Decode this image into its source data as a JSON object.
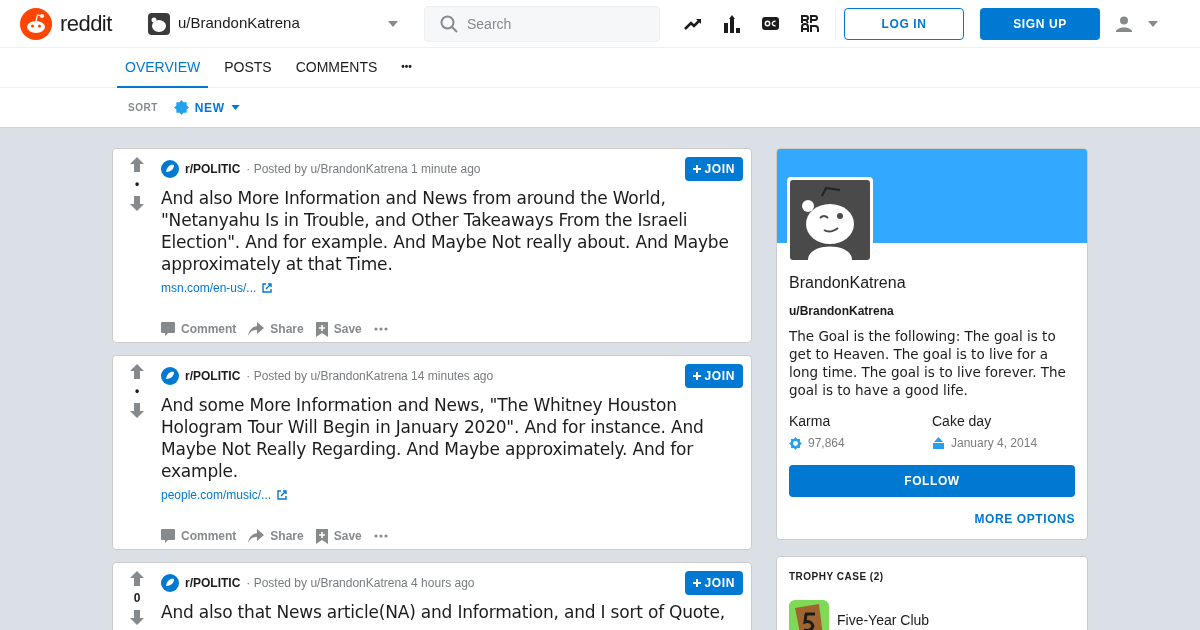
{
  "header": {
    "logo": "reddit",
    "profile_switcher": "u/BrandonKatrena",
    "search": {
      "placeholder": "Search"
    },
    "login": "LOG IN",
    "signup": "SIGN UP"
  },
  "tabs": [
    {
      "label": "OVERVIEW",
      "selected": true
    },
    {
      "label": "POSTS",
      "selected": false
    },
    {
      "label": "COMMENTS",
      "selected": false
    },
    {
      "label": "•••",
      "selected": false
    }
  ],
  "sort": {
    "label": "SORT",
    "value": "NEW"
  },
  "posts": [
    {
      "votes": "•",
      "subreddit": "r/POLITIC",
      "byline": "· Posted by u/BrandonKatrena 1 minute ago",
      "join": "JOIN",
      "title": "And also More Information and News from around the World, \"Netanyahu Is in Trouble, and Other Takeaways From the Israeli Election\". And for example. And Maybe Not really about. And Maybe approximately at that Time.",
      "link": "msn.com/en-us/...",
      "actions": [
        "Comment",
        "Share",
        "Save"
      ]
    },
    {
      "votes": "•",
      "subreddit": "r/POLITIC",
      "byline": "· Posted by u/BrandonKatrena 14 minutes ago",
      "join": "JOIN",
      "title": "And some More Information and News, \"The Whitney Houston Hologram Tour Will Begin in January 2020\". And for instance. And Maybe Not Really Regarding. And Maybe approximately. And for example.",
      "link": "people.com/music/...",
      "actions": [
        "Comment",
        "Share",
        "Save"
      ]
    },
    {
      "votes": "0",
      "subreddit": "r/POLITIC",
      "byline": "· Posted by u/BrandonKatrena 4 hours ago",
      "join": "JOIN",
      "title": "And also that News article(NA) and Information, and I sort of Quote,"
    }
  ],
  "profile": {
    "display_name": "BrandonKatrena",
    "username": "u/BrandonKatrena",
    "bio": "The Goal is the following: The goal is to get to Heaven. The goal is to live for a long time. The goal is to live forever. The goal is to have a good life.",
    "karma_label": "Karma",
    "karma": "97,864",
    "cakeday_label": "Cake day",
    "cakeday": "January 4, 2014",
    "follow": "FOLLOW",
    "more_options": "MORE OPTIONS"
  },
  "trophy_case": {
    "title": "TROPHY CASE (2)",
    "trophies": [
      {
        "name": "Five-Year Club"
      }
    ]
  }
}
